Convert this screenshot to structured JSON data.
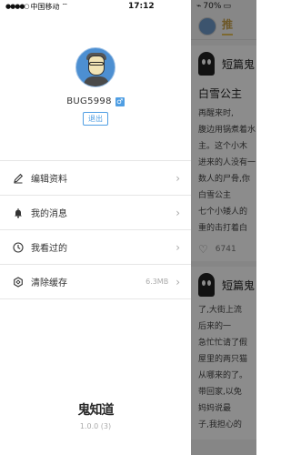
{
  "status": {
    "carrier": "中国移动",
    "time": "17:12",
    "battery": "70%"
  },
  "profile": {
    "username": "BUG5998",
    "gender_symbol": "♂",
    "logout_label": "退出"
  },
  "menu": [
    {
      "label": "编辑资料",
      "value": "",
      "icon": "edit-icon"
    },
    {
      "label": "我的消息",
      "value": "",
      "icon": "bell-icon"
    },
    {
      "label": "我看过的",
      "value": "",
      "icon": "clock-icon"
    },
    {
      "label": "清除缓存",
      "value": "6.3MB",
      "icon": "clear-cache-icon"
    }
  ],
  "brand": {
    "logo": "鬼知道",
    "version": "1.0.0 (3)"
  },
  "feed": {
    "tab_label": "推",
    "cards": [
      {
        "title": "短篇鬼",
        "subtitle": "白雪公主",
        "lines": [
          "再醒来时,",
          "腹边用锅煮着水",
          "主。这个小木",
          "进来的人没有一",
          "数人的尸骨,你",
          "",
          "白雪公主",
          "七个小矮人的",
          "重的击打着白"
        ],
        "likes": "6741"
      },
      {
        "title": "短篇鬼",
        "subtitle": "",
        "lines": [
          "了,大街上流",
          "",
          "后来的一",
          "急忙忙请了假",
          "屋里的两只猫",
          "从哪来的了。",
          "带回家,以免",
          "",
          "妈妈说最",
          "子,我担心的"
        ],
        "likes": ""
      }
    ]
  },
  "colors": {
    "accent_blue": "#4f9ee3",
    "accent_gold": "#c79b2a"
  }
}
